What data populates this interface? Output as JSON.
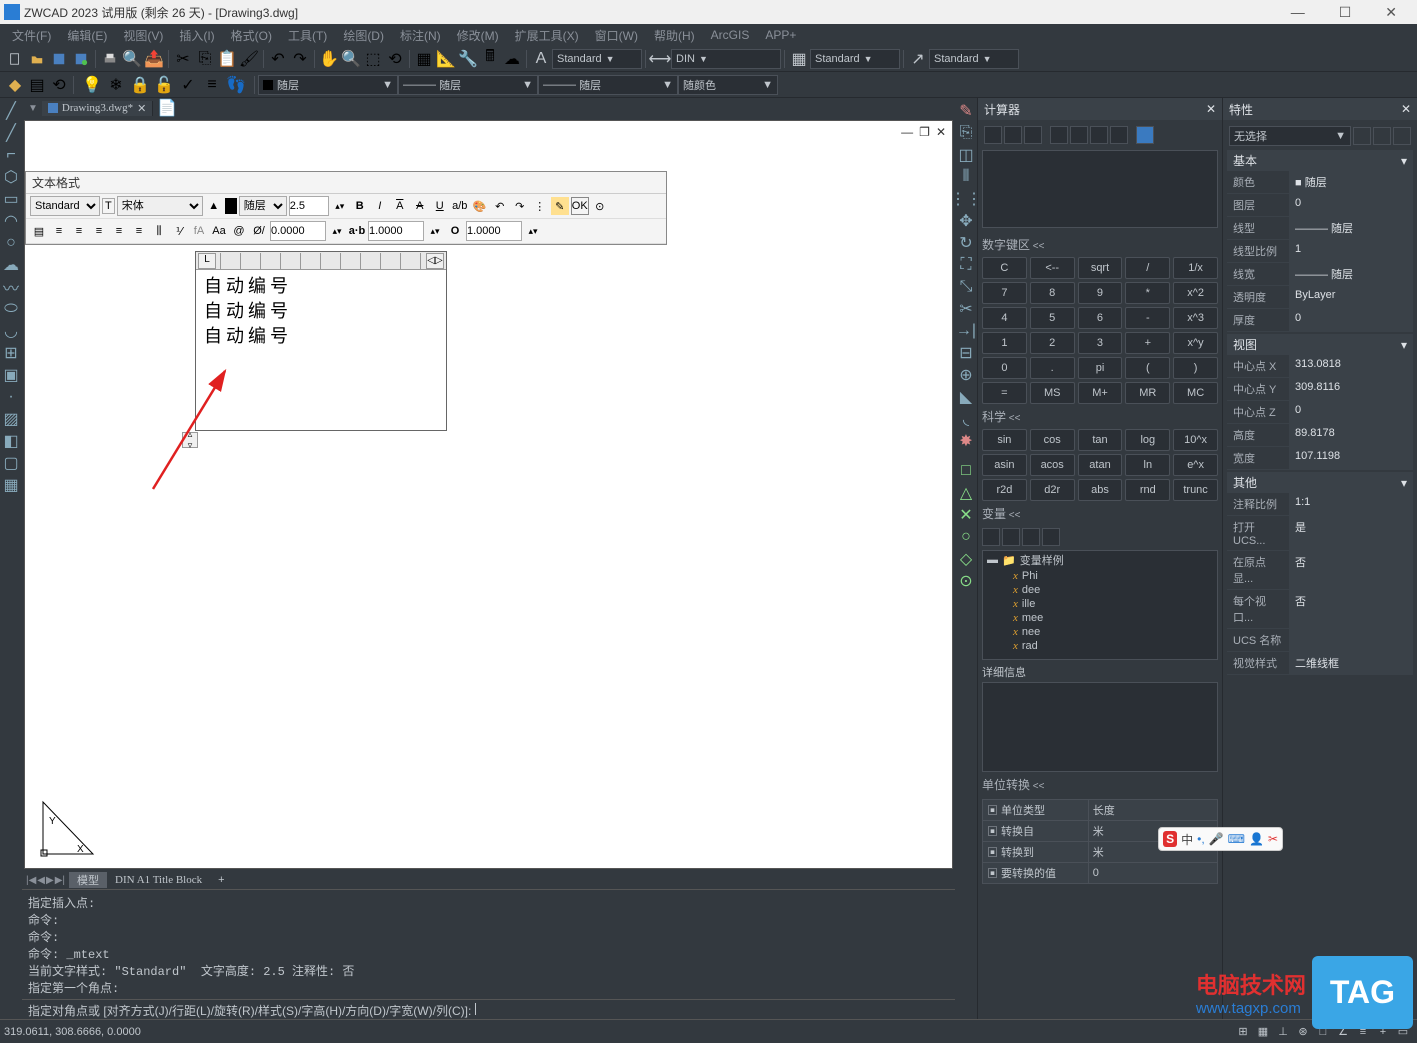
{
  "window": {
    "title": "ZWCAD 2023 试用版 (剩余 26 天) - [Drawing3.dwg]"
  },
  "menus": [
    "文件(F)",
    "编辑(E)",
    "视图(V)",
    "插入(I)",
    "格式(O)",
    "工具(T)",
    "绘图(D)",
    "标注(N)",
    "修改(M)",
    "扩展工具(X)",
    "窗口(W)",
    "帮助(H)",
    "ArcGIS",
    "APP+"
  ],
  "toolbar": {
    "text_style": "Standard",
    "dim_style": "DIN",
    "table_style": "Standard",
    "mleader_style": "Standard",
    "layer_combo": "随层",
    "color_combo": "随颜色"
  },
  "file_tab": {
    "name": "Drawing3.dwg*"
  },
  "text_format": {
    "title": "文本格式",
    "style": "Standard",
    "font": "宋体",
    "color_label": "随层",
    "height": "2.5",
    "ok": "OK",
    "tracking": "0.0000",
    "width1": "1.0000",
    "width2": "1.0000"
  },
  "mtext": {
    "line1": "自动编号",
    "line2": "自动编号",
    "line3": "自动编号"
  },
  "layout_tabs": {
    "model": "模型",
    "layout1": "DIN A1 Title Block"
  },
  "command": {
    "history": "指定插入点:\n命令:\n命令:\n命令: _mtext\n当前文字样式: \"Standard\"  文字高度: 2.5 注释性: 否\n指定第一个角点:",
    "prompt": "指定对角点或 [对齐方式(J)/行距(L)/旋转(R)/样式(S)/字高(H)/方向(D)/字宽(W)/列(C)]: "
  },
  "status": {
    "coords": "319.0611, 308.6666, 0.0000"
  },
  "calculator": {
    "title": "计算器",
    "numpad_hdr": "数字键区",
    "sci_hdr": "科学",
    "var_hdr": "变量",
    "detail_hdr": "详细信息",
    "unit_hdr": "单位转换",
    "numpad": [
      [
        "C",
        "<--",
        "sqrt",
        "/",
        "1/x"
      ],
      [
        "7",
        "8",
        "9",
        "*",
        "x^2"
      ],
      [
        "4",
        "5",
        "6",
        "-",
        "x^3"
      ],
      [
        "1",
        "2",
        "3",
        "+",
        "x^y"
      ],
      [
        "0",
        ".",
        "pi",
        "(",
        ")"
      ],
      [
        "=",
        "MS",
        "M+",
        "MR",
        "MC"
      ]
    ],
    "sci": [
      [
        "sin",
        "cos",
        "tan",
        "log",
        "10^x"
      ],
      [
        "asin",
        "acos",
        "atan",
        "ln",
        "e^x"
      ],
      [
        "r2d",
        "d2r",
        "abs",
        "rnd",
        "trunc"
      ]
    ],
    "var_root": "变量样例",
    "vars": [
      "Phi",
      "dee",
      "ille",
      "mee",
      "nee",
      "rad"
    ],
    "unit_rows": [
      [
        "单位类型",
        "长度"
      ],
      [
        "转换自",
        "米"
      ],
      [
        "转换到",
        "米"
      ],
      [
        "要转换的值",
        "0"
      ]
    ]
  },
  "properties": {
    "title": "特性",
    "sel": "无选择",
    "groups": {
      "basic": {
        "hdr": "基本",
        "rows": [
          [
            "颜色",
            "■ 随层"
          ],
          [
            "图层",
            "0"
          ],
          [
            "线型",
            "——— 随层"
          ],
          [
            "线型比例",
            "1"
          ],
          [
            "线宽",
            "——— 随层"
          ],
          [
            "透明度",
            "ByLayer"
          ],
          [
            "厚度",
            "0"
          ]
        ]
      },
      "view": {
        "hdr": "视图",
        "rows": [
          [
            "中心点 X",
            "313.0818"
          ],
          [
            "中心点 Y",
            "309.8116"
          ],
          [
            "中心点 Z",
            "0"
          ],
          [
            "高度",
            "89.8178"
          ],
          [
            "宽度",
            "107.1198"
          ]
        ]
      },
      "other": {
        "hdr": "其他",
        "rows": [
          [
            "注释比例",
            "1:1"
          ],
          [
            "打开 UCS...",
            "是"
          ],
          [
            "在原点显...",
            "否"
          ],
          [
            "每个视口...",
            "否"
          ],
          [
            "UCS 名称",
            ""
          ],
          [
            "视觉样式",
            "二维线框"
          ]
        ]
      }
    }
  },
  "watermark": {
    "site": "电脑技术网",
    "url": "www.tagxp.com",
    "tag": "TAG"
  }
}
